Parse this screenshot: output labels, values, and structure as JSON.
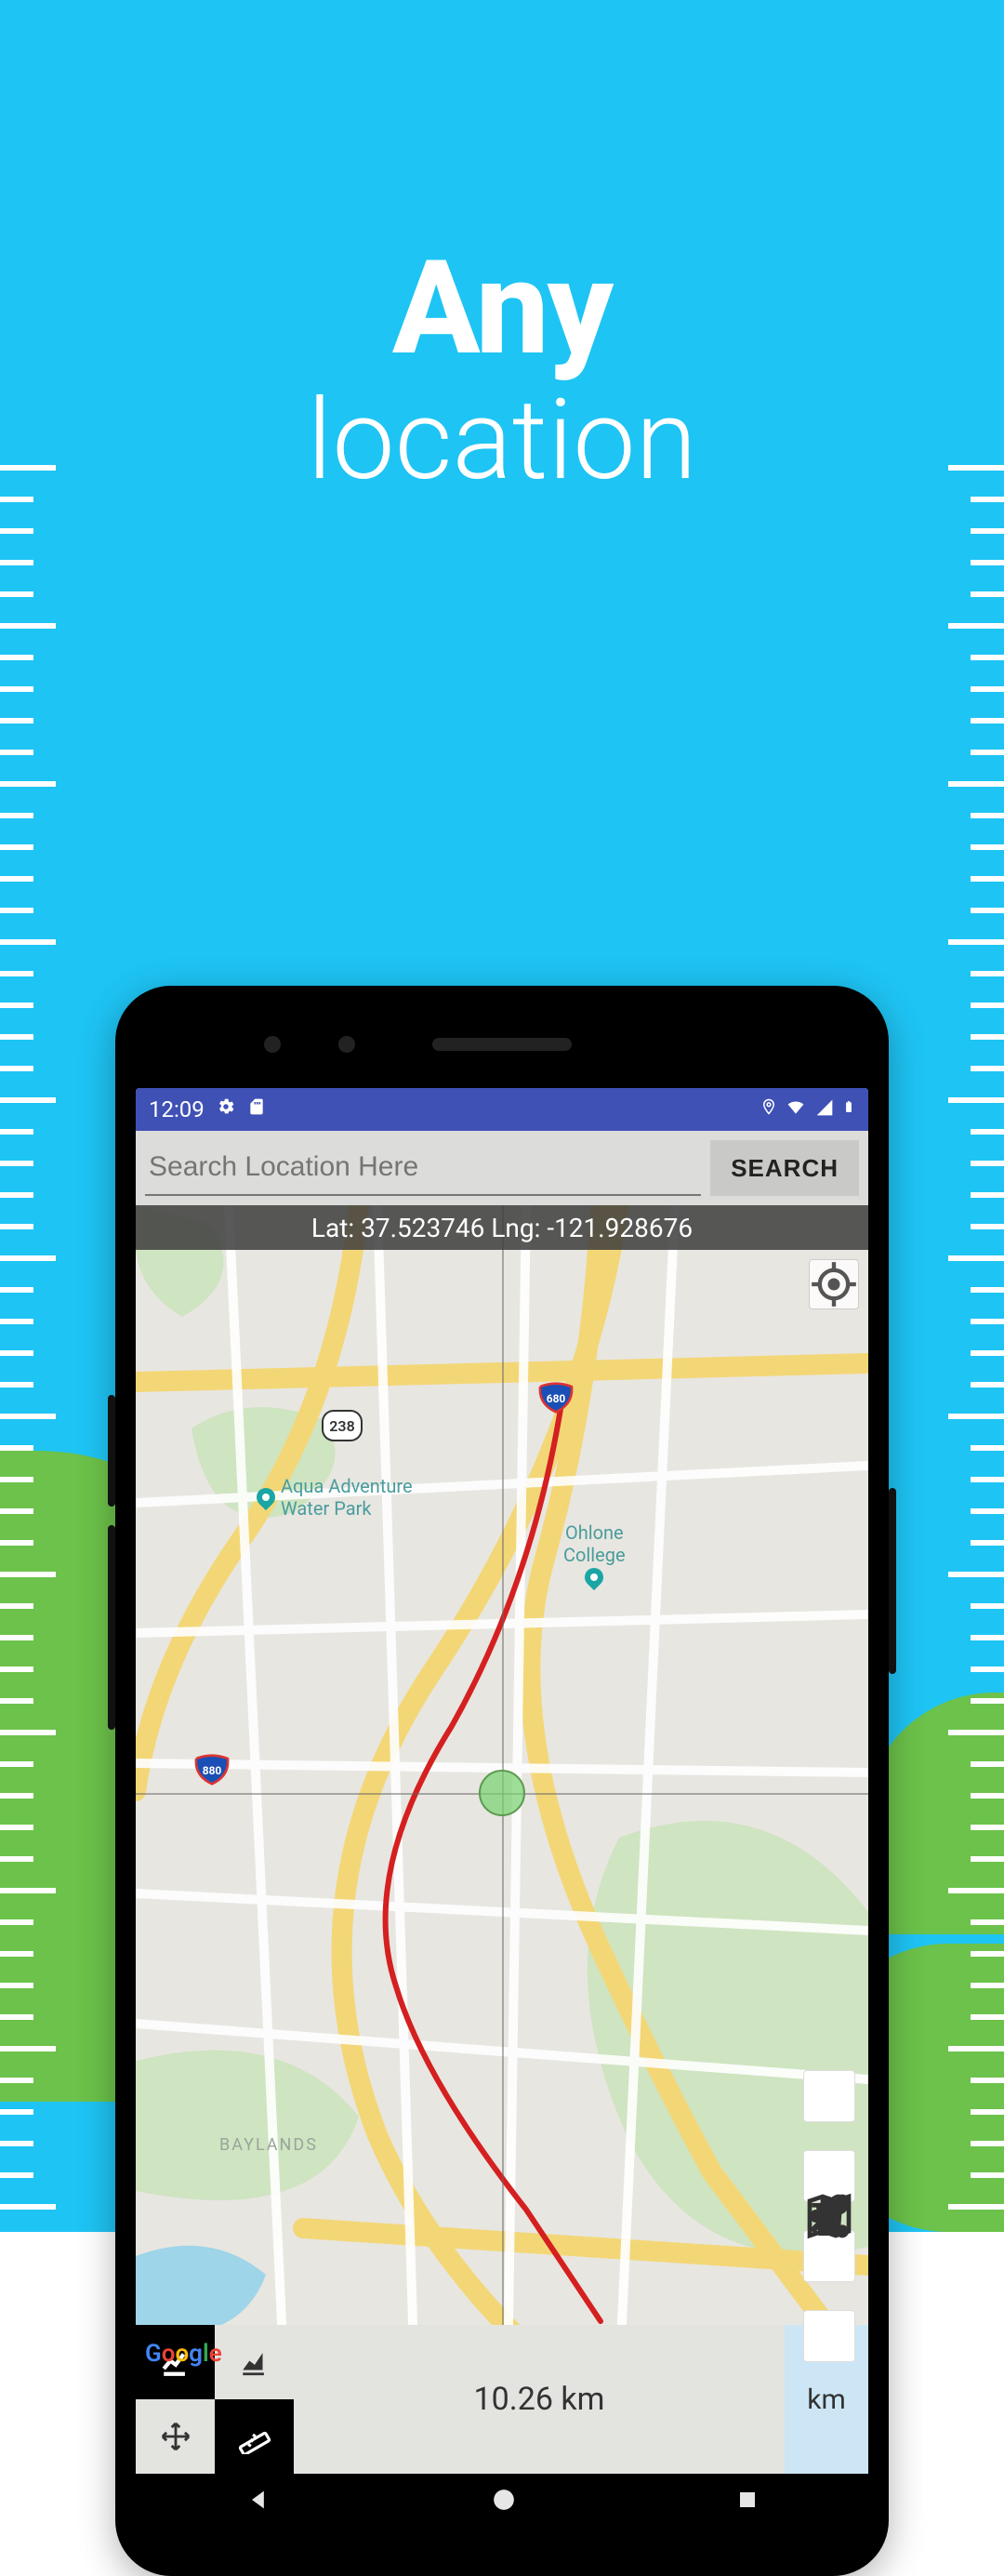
{
  "promo": {
    "line1": "Any",
    "line2": "location"
  },
  "statusbar": {
    "time": "12:09"
  },
  "search": {
    "placeholder": "Search Location Here",
    "button": "SEARCH"
  },
  "coords": {
    "text": "Lat: 37.523746 Lng: -121.928676"
  },
  "map": {
    "poi1": "Aqua Adventure\nWater Park",
    "poi2": "Ohlone\nCollege",
    "district": "BAYLANDS",
    "shields": {
      "r238": "238",
      "i680": "680",
      "i880": "880"
    },
    "attribution": "Google"
  },
  "measure": {
    "value": "10.26 km",
    "unit": "km"
  }
}
